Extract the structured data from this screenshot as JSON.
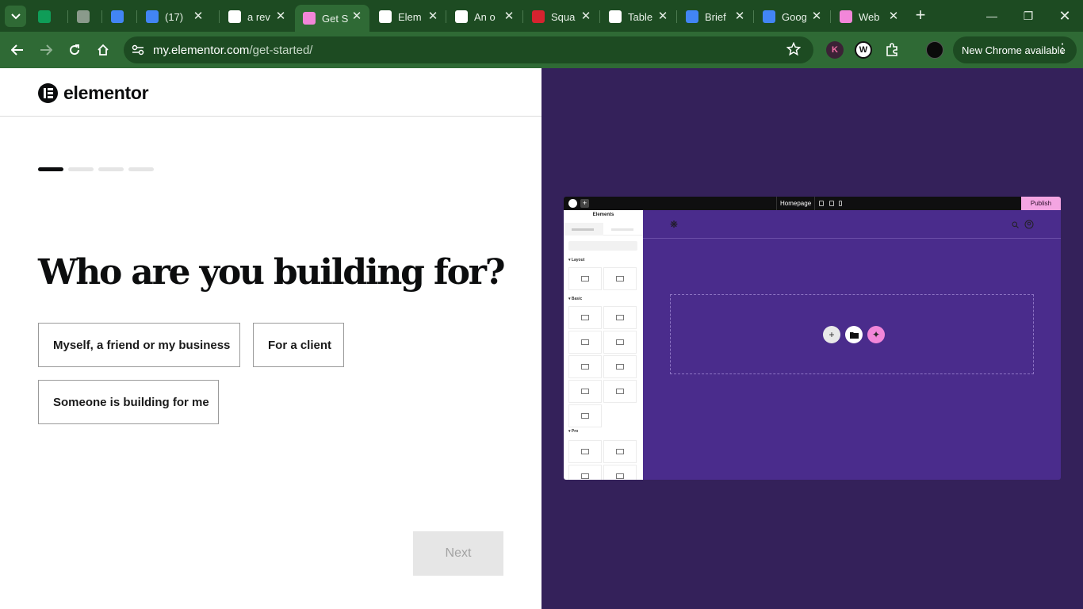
{
  "browser": {
    "tabs": [
      {
        "title": "",
        "favicon": "sheets-icon",
        "color": "#0f9d58"
      },
      {
        "title": "",
        "favicon": "globe-icon",
        "color": "#8a9a8b"
      },
      {
        "title": "",
        "favicon": "docs-icon",
        "color": "#4285f4"
      },
      {
        "title": "(17)",
        "favicon": "docs-icon",
        "color": "#4285f4"
      },
      {
        "title": "a rev",
        "favicon": "google-icon",
        "color": "#ffffff"
      },
      {
        "title": "Get S",
        "favicon": "elementor-icon",
        "color": "#f286d9"
      },
      {
        "title": "Elem",
        "favicon": "wordpress-icon",
        "color": "#ffffff"
      },
      {
        "title": "An o",
        "favicon": "google-icon",
        "color": "#ffffff"
      },
      {
        "title": "Squa",
        "favicon": "pc-icon",
        "color": "#d6232f"
      },
      {
        "title": "Table",
        "favicon": "openai-icon",
        "color": "#ffffff"
      },
      {
        "title": "Brief",
        "favicon": "docs-icon",
        "color": "#4285f4"
      },
      {
        "title": "Goog",
        "favicon": "docs-icon",
        "color": "#4285f4"
      },
      {
        "title": "Web",
        "favicon": "elementor-icon",
        "color": "#f286d9"
      }
    ],
    "address": {
      "host": "my.elementor.com",
      "path": "/get-started/"
    },
    "new_chrome": "New Chrome available"
  },
  "page": {
    "brand": "elementor",
    "progress": {
      "current": 1,
      "total": 4
    },
    "question": "Who are you building for?",
    "options": [
      "Myself, a friend or my business",
      "For a client",
      "Someone is building for me"
    ],
    "next_label": "Next"
  },
  "preview": {
    "page_name": "Homepage",
    "publish_label": "Publish",
    "panel_title": "Elements",
    "sections": [
      "Layout",
      "Basic",
      "Pro"
    ]
  }
}
